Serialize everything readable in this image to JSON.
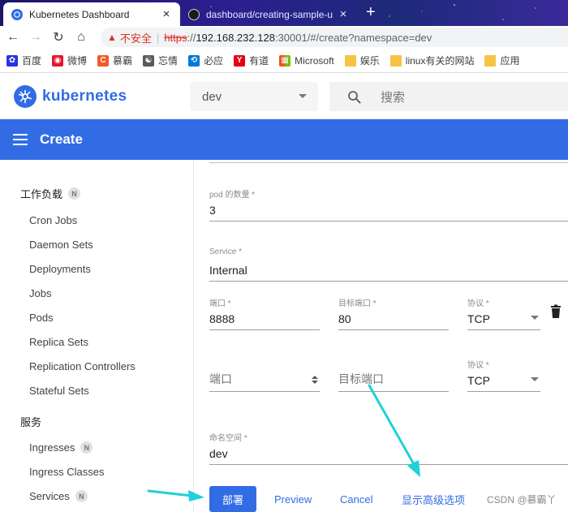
{
  "browser": {
    "tabs": [
      {
        "title": "Kubernetes Dashboard",
        "close": "×"
      },
      {
        "title": "dashboard/creating-sample-u",
        "close": "×"
      }
    ],
    "new_tab": "+",
    "nav": {
      "back": "←",
      "forward": "→",
      "reload": "↻",
      "home": "⌂"
    },
    "address": {
      "warning_icon": "▲",
      "insecure_label": "不安全",
      "separator": "|",
      "scheme": "https",
      "scheme_sep": "://",
      "host": "192.168.232.128",
      "path": ":30001/#/create?namespace=dev"
    },
    "bookmarks": [
      {
        "label": "百度",
        "color": "#2932e1",
        "glyph": "✿"
      },
      {
        "label": "微博",
        "color": "#e6162d",
        "glyph": "◉"
      },
      {
        "label": "慕霸",
        "color": "#f25a29",
        "glyph": "C"
      },
      {
        "label": "忘情",
        "color": "#5a5a5a",
        "glyph": "☯"
      },
      {
        "label": "必应",
        "color": "#0078d4",
        "glyph": "⟲"
      },
      {
        "label": "有道",
        "color": "#e60012",
        "glyph": "Y"
      },
      {
        "label": "Microsoft",
        "color": "#f25022",
        "glyph": "▦"
      },
      {
        "label": "娱乐",
        "color": "#f6c343",
        "glyph": ""
      },
      {
        "label": "linux有关的网站",
        "color": "#f6c343",
        "glyph": ""
      },
      {
        "label": "应用",
        "color": "#f6c343",
        "glyph": ""
      }
    ]
  },
  "header": {
    "brand": "kubernetes",
    "namespace": "dev",
    "search_placeholder": "搜索"
  },
  "toolbar": {
    "title": "Create"
  },
  "sidebar": {
    "workloads": {
      "label": "工作负载",
      "badge": "N"
    },
    "workload_items": [
      {
        "label": "Cron Jobs"
      },
      {
        "label": "Daemon Sets"
      },
      {
        "label": "Deployments"
      },
      {
        "label": "Jobs"
      },
      {
        "label": "Pods"
      },
      {
        "label": "Replica Sets"
      },
      {
        "label": "Replication Controllers"
      },
      {
        "label": "Stateful Sets"
      }
    ],
    "services": {
      "label": "服务"
    },
    "service_items": [
      {
        "label": "Ingresses",
        "badge": "N"
      },
      {
        "label": "Ingress Classes",
        "badge": ""
      },
      {
        "label": "Services",
        "badge": "N"
      }
    ]
  },
  "form": {
    "pods": {
      "label": "pod 的数量 *",
      "value": "3"
    },
    "service": {
      "label": "Service *",
      "value": "Internal"
    },
    "ports_row1": {
      "port": {
        "label": "端口 *",
        "value": "8888"
      },
      "target": {
        "label": "目标端口 *",
        "value": "80"
      },
      "protocol": {
        "label": "协议 *",
        "value": "TCP"
      }
    },
    "ports_row2": {
      "port": {
        "placeholder": "端口"
      },
      "target": {
        "placeholder": "目标端口"
      },
      "protocol": {
        "label": "协议 *",
        "value": "TCP"
      }
    },
    "namespace": {
      "label": "命名空间 *",
      "value": "dev"
    }
  },
  "actions": {
    "deploy": "部署",
    "preview": "Preview",
    "cancel": "Cancel",
    "advanced": "显示高级选项"
  },
  "watermark": "CSDN @慕霸丫",
  "colors": {
    "accent": "#326ce5",
    "annotation_arrow": "#1fd1d9"
  }
}
